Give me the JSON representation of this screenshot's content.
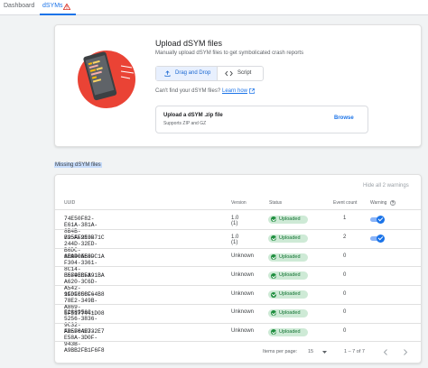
{
  "tabs": [
    {
      "label": "Dashboard"
    },
    {
      "label": "dSYMs"
    }
  ],
  "colors": {
    "accent": "#1a73e8",
    "warning": "#d93025",
    "success": "#137333",
    "illustration": "#ea4335"
  },
  "upload": {
    "title": "Upload dSYM files",
    "subtitle": "Manually upload dSYM files to get symbolicated crash reports",
    "drag_drop_label": "Drag and Drop",
    "script_label": "Script",
    "cant_find": "Can't find your dSYM files?",
    "learn_how": "Learn how",
    "dropzone_title": "Upload a dSYM .zip file",
    "dropzone_sub": "Supports ZIP and GZ",
    "browse_label": "Browse"
  },
  "missing": {
    "title": "Missing dSYM files",
    "hide_all": "Hide all 2 warnings",
    "columns": {
      "uuid": "UUID",
      "version": "Version",
      "status": "Status",
      "event_count": "Event count",
      "warning": "Warning"
    },
    "rows": [
      {
        "uuid": "74E50F82-E61A-381A-8B4B-B95AE9E3B71C",
        "version": "1.0 (1)",
        "status": "Uploaded",
        "count": "1",
        "warning": true
      },
      {
        "uuid": "725FF210-244D-32ED-B6DC-6D9D0A69DC1A",
        "version": "1.0 (1)",
        "status": "Uploaded",
        "count": "2",
        "warning": true
      },
      {
        "uuid": "AEA405E8-F304-3361-8C14-B634EBF391BA",
        "version": "Unknown",
        "status": "Uploaded",
        "count": "0",
        "warning": false
      },
      {
        "uuid": "E5F93C5A-A620-3C6D-A542-9F0FCCCF64B8",
        "version": "Unknown",
        "status": "Uploaded",
        "count": "0",
        "warning": false
      },
      {
        "uuid": "11D1858C-78E2-349B-A869-5F5177441D08",
        "version": "Unknown",
        "status": "Uploaded",
        "count": "0",
        "warning": false
      },
      {
        "uuid": "E288956C-5256-3836-9C32-A25F0AE332E7",
        "version": "Unknown",
        "status": "Uploaded",
        "count": "0",
        "warning": false
      },
      {
        "uuid": "FBE36497-E58A-3D0F-943B-A9BB2FB1F6F8",
        "version": "Unknown",
        "status": "Uploaded",
        "count": "0",
        "warning": false
      }
    ],
    "pagination": {
      "items_per_page_label": "Items per page:",
      "items_per_page": "15",
      "range": "1 – 7 of 7"
    }
  }
}
